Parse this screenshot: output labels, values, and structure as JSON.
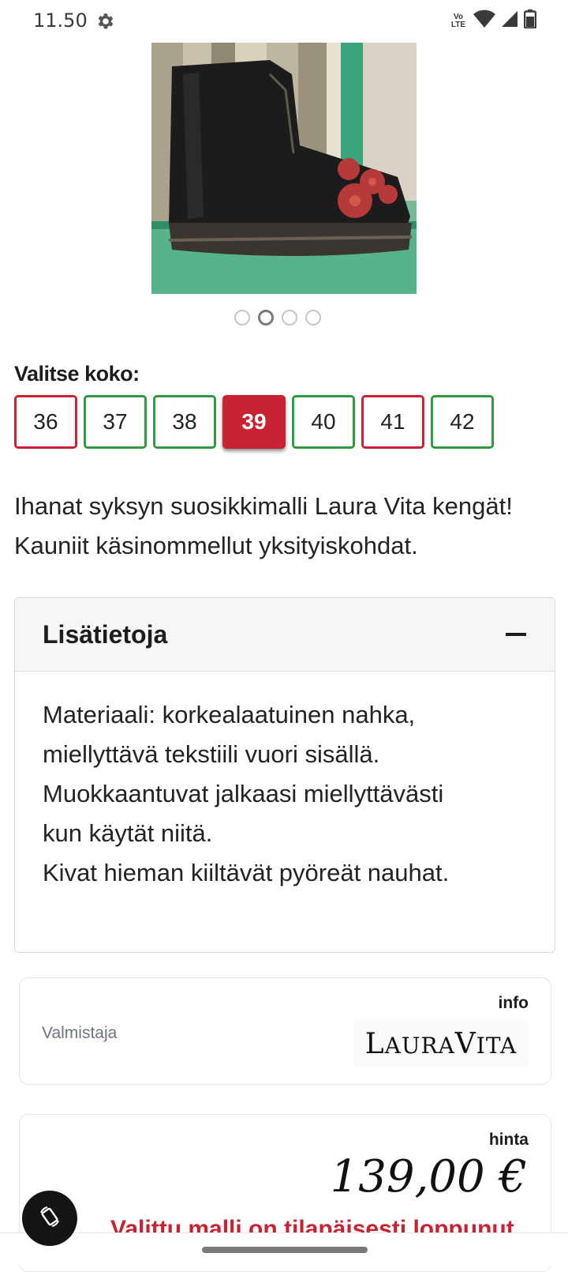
{
  "status_bar": {
    "time": "11.50",
    "lte_top": "Vo",
    "lte_bottom": "LTE",
    "icons": [
      "gear-icon",
      "volte-icon",
      "wifi-icon",
      "signal-icon",
      "battery-icon"
    ]
  },
  "gallery": {
    "image_description_icon": "boot-photo",
    "page_count": 4,
    "active_page": 2
  },
  "size_selector": {
    "label": "Valitse koko:",
    "sizes": [
      {
        "label": "36",
        "state": "unavailable"
      },
      {
        "label": "37",
        "state": "available"
      },
      {
        "label": "38",
        "state": "available"
      },
      {
        "label": "39",
        "state": "selected"
      },
      {
        "label": "40",
        "state": "available"
      },
      {
        "label": "41",
        "state": "unavailable"
      },
      {
        "label": "42",
        "state": "available"
      }
    ]
  },
  "description": {
    "line1": "Ihanat syksyn suosikkimalli Laura Vita kengät!",
    "line2": "Kauniit käsinommellut yksityiskohdat."
  },
  "details": {
    "title": "Lisätietoja",
    "expanded": true,
    "line1": "Materiaali: korkealaatuinen nahka,",
    "line2": "miellyttävä tekstiili vuori sisällä.",
    "line3": "Muokkaantuvat jalkaasi miellyttävästi",
    "line4": "kun käytät niitä.",
    "line5": "Kivat hieman kiiltävät pyöreät nauhat."
  },
  "info": {
    "heading": "info",
    "maker_label": "Valmistaja",
    "maker_logo": "LAURAVITA"
  },
  "price": {
    "heading": "hinta",
    "value": "139,00 €",
    "stock_note": "Valittu malli on tilapäisesti loppunut"
  },
  "colors": {
    "accent_red": "#c82333",
    "available_green": "#2f9a3f"
  }
}
